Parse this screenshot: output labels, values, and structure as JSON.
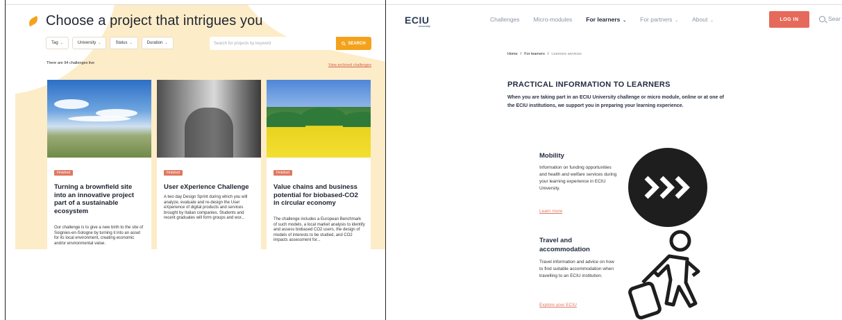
{
  "left": {
    "title": "Choose a project that intrigues you",
    "filters": [
      {
        "label": "Tag"
      },
      {
        "label": "University"
      },
      {
        "label": "Status"
      },
      {
        "label": "Duration"
      }
    ],
    "search_placeholder": "Search for projects by keyword",
    "search_button": "SEARCH",
    "count_text": "There are 94 challenges live",
    "archived_link": "View archived challenges",
    "cards": [
      {
        "badge": "Finished",
        "title": "Turning a brownfield site into an innovative project part of a sustainable ecosystem",
        "desc": "Our challenge is to give a new birth to the site of Soignies-en-Sologne by turning it into an asset for its local environment, creating economic and/or environmental value."
      },
      {
        "badge": "Finished",
        "title": "User eXperience Challenge",
        "desc": "A two day Design Sprint during which you will analyze, evaluate and re-design the User eXperience of digital products and services brought by Italian companies. Students and recent graduates will form groups and wor..."
      },
      {
        "badge": "Finished",
        "title": "Value chains and business potential for biobased-CO2 in circular economy",
        "desc": "The challenge includes a European Benchmark of such models, a local market analysis to identify and assess biobased CO2 users, the design of models of interests to be studied, and CO2 impacts assessment for..."
      }
    ],
    "colors": {
      "accent": "#f4a21c",
      "badge": "#e07862",
      "background": "#fdecc8"
    }
  },
  "right": {
    "logo": "ECIU",
    "logo_sub": "university",
    "nav": [
      {
        "label": "Challenges",
        "has_menu": false
      },
      {
        "label": "Micro-modules",
        "has_menu": false
      },
      {
        "label": "For learners",
        "has_menu": true
      },
      {
        "label": "For partners",
        "has_menu": true
      },
      {
        "label": "About",
        "has_menu": true
      }
    ],
    "login": "LOG IN",
    "search": "Sear",
    "breadcrumb": [
      "Home",
      "For learners",
      "Learners services"
    ],
    "section_title": "PRACTICAL INFORMATION TO LEARNERS",
    "intro": "When you are taking part in an ECIU University challenge or micro module, online or at one of the ECIU institutions, we support you in preparing your learning experience.",
    "mobility": {
      "title": "Mobility",
      "desc": "Information on funding opportunities and health and welfare services during your learning experience in ECIU University.",
      "link": "Learn more"
    },
    "travel": {
      "title_line1": "Travel and",
      "title_line2": "accommodation",
      "desc": "Travel information and advice on how to find suitable accommodation when travelling to an ECIU institution.",
      "link": "Explore your ECIU"
    },
    "icons": {
      "mobility": "triple-chevron-right-icon",
      "travel": "traveler-with-suitcase-icon"
    },
    "colors": {
      "login": "#e66a5c",
      "link": "#e07862"
    }
  }
}
